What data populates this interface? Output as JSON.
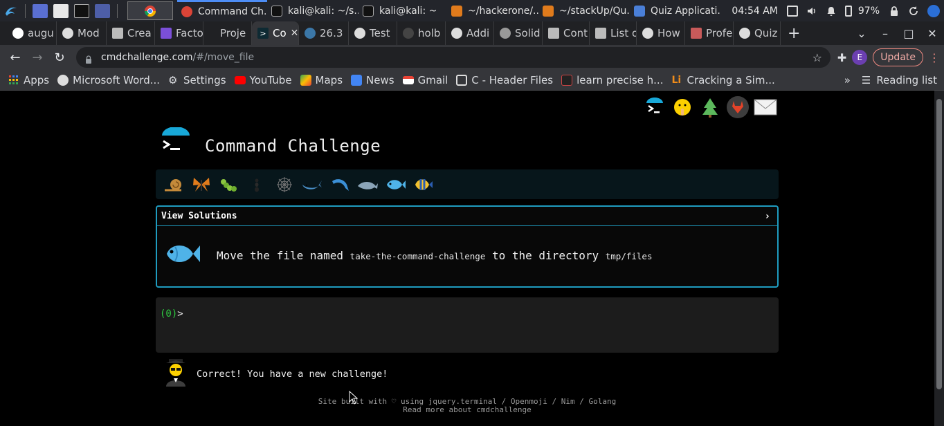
{
  "taskbar": {
    "tasks": [
      {
        "label": "Command Ch...",
        "icon": "chrome-icon"
      },
      {
        "label": "kali@kali: ~/s...",
        "icon": "terminal-icon"
      },
      {
        "label": "kali@kali: ~",
        "icon": "terminal-icon"
      },
      {
        "label": "~/hackerone/...",
        "icon": "sublime-icon"
      },
      {
        "label": "~/stackUp/Qu...",
        "icon": "sublime-icon"
      },
      {
        "label": "Quiz Applicati...",
        "icon": "folder-icon"
      }
    ],
    "time": "04:54 AM",
    "battery": "97%"
  },
  "tabs": [
    {
      "label": "augu",
      "icon": "google-icon"
    },
    {
      "label": "Mod",
      "icon": "globe-icon"
    },
    {
      "label": "Crea",
      "icon": "book-icon"
    },
    {
      "label": "Facto",
      "icon": "shield-icon"
    },
    {
      "label": "Proje",
      "icon": "blank-icon"
    },
    {
      "label": "Co",
      "icon": "terminal-icon",
      "active": true
    },
    {
      "label": "26.3",
      "icon": "python-icon"
    },
    {
      "label": "Test",
      "icon": "globe-icon"
    },
    {
      "label": "holb",
      "icon": "github-icon"
    },
    {
      "label": "Addi",
      "icon": "github-icon"
    },
    {
      "label": "Solid",
      "icon": "link-icon"
    },
    {
      "label": "Cont",
      "icon": "book-icon"
    },
    {
      "label": "List o",
      "icon": "book-icon"
    },
    {
      "label": "How",
      "icon": "globe-icon"
    },
    {
      "label": "Profe",
      "icon": "shield-icon"
    },
    {
      "label": "Quiz",
      "icon": "globe-icon"
    }
  ],
  "omnibox": {
    "host": "cmdchallenge.com",
    "path": "/#/move_file"
  },
  "toolbar": {
    "profile_initial": "E",
    "update_label": "Update"
  },
  "bookmarks": {
    "items": [
      {
        "label": "Apps",
        "icon": "apps-grid-icon"
      },
      {
        "label": "Microsoft Word...",
        "icon": "globe-icon"
      },
      {
        "label": "Settings",
        "icon": "gear-icon"
      },
      {
        "label": "YouTube",
        "icon": "youtube-icon"
      },
      {
        "label": "Maps",
        "icon": "maps-icon"
      },
      {
        "label": "News",
        "icon": "news-icon"
      },
      {
        "label": "Gmail",
        "icon": "gmail-icon"
      },
      {
        "label": "C - Header Files",
        "icon": "c-icon"
      },
      {
        "label": "learn precise h...",
        "icon": "doc-icon"
      },
      {
        "label": "Cracking a Sim...",
        "icon": "li-icon"
      }
    ],
    "reading_list": "Reading list"
  },
  "page": {
    "title": "Command Challenge",
    "view_solutions": "View Solutions",
    "task": {
      "prefix": "Move the file named",
      "file": "take-the-command-challenge",
      "middle": "to the directory",
      "dir": "tmp/files"
    },
    "prompt_num": "(0)",
    "prompt_char": ">",
    "feedback": "Correct! You have a new challenge!",
    "footer_line1": "Site built with ♡ using jquery.terminal / Openmoji / Nim / Golang",
    "footer_line2": "Read more about cmdchallenge"
  },
  "colors": {
    "accent_border": "#1f9cc0",
    "prompt_green": "#2ecc40",
    "level_bar_bg": "#07161b"
  }
}
